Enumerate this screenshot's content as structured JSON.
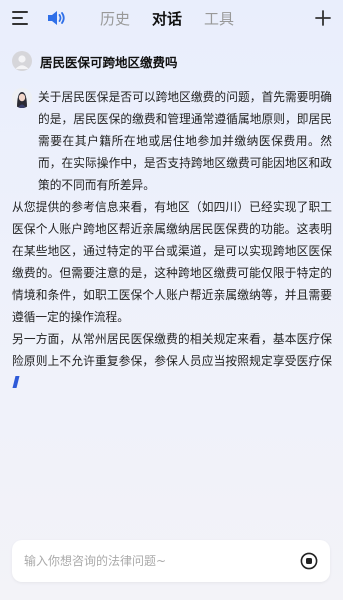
{
  "header": {
    "tabs": [
      {
        "label": "历史",
        "active": false
      },
      {
        "label": "对话",
        "active": true
      },
      {
        "label": "工具",
        "active": false
      }
    ],
    "icons": {
      "menu": "menu-icon",
      "speaker": "speaker-icon",
      "add": "plus-icon"
    },
    "accent_color": "#2f5bd8"
  },
  "conversation": {
    "question": "居民医保可跨地区缴费吗",
    "answer_paragraphs": [
      "关于居民医保是否可以跨地区缴费的问题，首先需要明确的是，居民医保的缴费和管理通常遵循属地原则，即居民需要在其户籍所在地或居住地参加并缴纳医保费用。然而，在实际操作中，是否支持跨地区缴费可能因地区和政策的不同而有所差异。",
      "从您提供的参考信息来看，有地区（如四川）已经实现了职工医保个人账户跨地区帮近亲属缴纳居民医保费的功能。这表明在某些地区，通过特定的平台或渠道，是可以实现跨地区医保缴费的。但需要注意的是，这种跨地区缴费可能仅限于特定的情境和条件，如职工医保个人账户帮近亲属缴纳等，并且需要遵循一定的操作流程。",
      "另一方面，从常州居民医保缴费的相关规定来看，基本医疗保险原则上不允许重复参保，参保人员应当按照规定享受医疗保"
    ]
  },
  "input": {
    "placeholder": "输入你想咨询的法律问题~",
    "value": ""
  }
}
